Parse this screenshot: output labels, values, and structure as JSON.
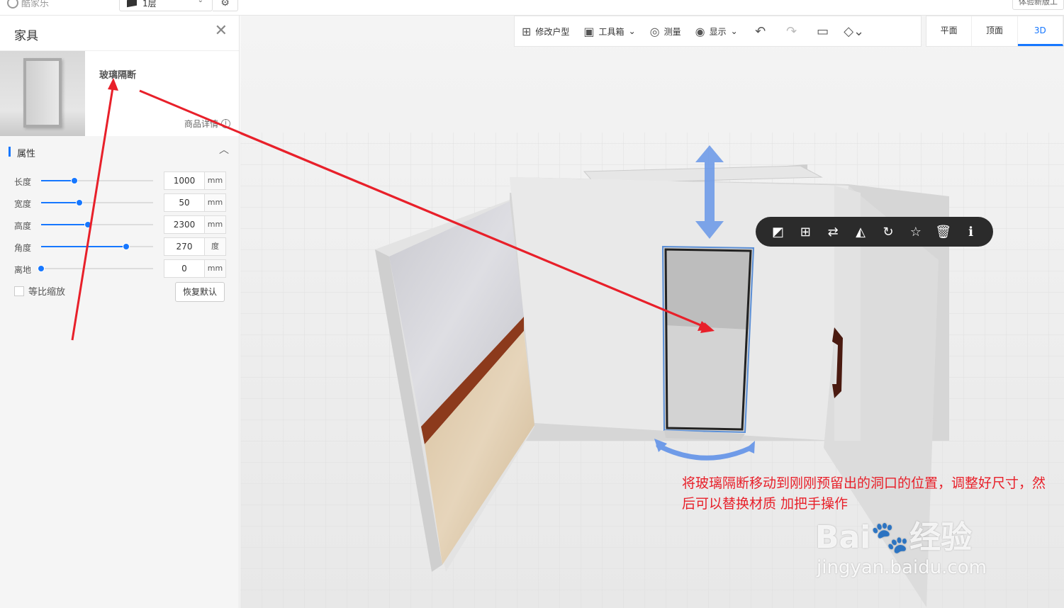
{
  "app": {
    "logo_text": "酷家乐",
    "floor": "1层",
    "right_top_button": "体验新版工"
  },
  "panel": {
    "title": "家具",
    "product_name": "玻璃隔断",
    "product_detail": "商品详情",
    "section_title": "属性",
    "attributes": [
      {
        "label": "长度",
        "value": "1000",
        "unit": "mm",
        "slider": 0.3
      },
      {
        "label": "宽度",
        "value": "50",
        "unit": "mm",
        "slider": 0.34
      },
      {
        "label": "高度",
        "value": "2300",
        "unit": "mm",
        "slider": 0.42
      },
      {
        "label": "角度",
        "value": "270",
        "unit": "度",
        "slider": 0.76
      },
      {
        "label": "离地",
        "value": "0",
        "unit": "mm",
        "slider": 0.0
      }
    ],
    "proportional_label": "等比缩放",
    "reset_label": "恢复默认"
  },
  "toolbar": {
    "items": [
      {
        "label": "修改户型",
        "icon": "floorplan-icon"
      },
      {
        "label": "工具箱",
        "icon": "toolbox-icon"
      },
      {
        "label": "测量",
        "icon": "measure-icon"
      },
      {
        "label": "显示",
        "icon": "eye-icon"
      }
    ],
    "view_tabs": [
      "平面",
      "顶面",
      "3D"
    ],
    "active_view": "3D"
  },
  "floating_toolbar": [
    "replace-material-icon",
    "add-icon",
    "swap-icon",
    "mirror-icon",
    "rotate-icon",
    "favorite-icon",
    "delete-icon",
    "info-icon"
  ],
  "annotation": "将玻璃隔断移动到刚刚预留出的洞口的位置，调整好尺寸，然后可以替换材质 加把手操作",
  "watermark": {
    "brand": "Bai🐾经验",
    "url": "jingyan.baidu.com"
  },
  "colors": {
    "accent": "#1677ff",
    "annotation": "#e8202a",
    "arrow": "#6f9be8"
  }
}
